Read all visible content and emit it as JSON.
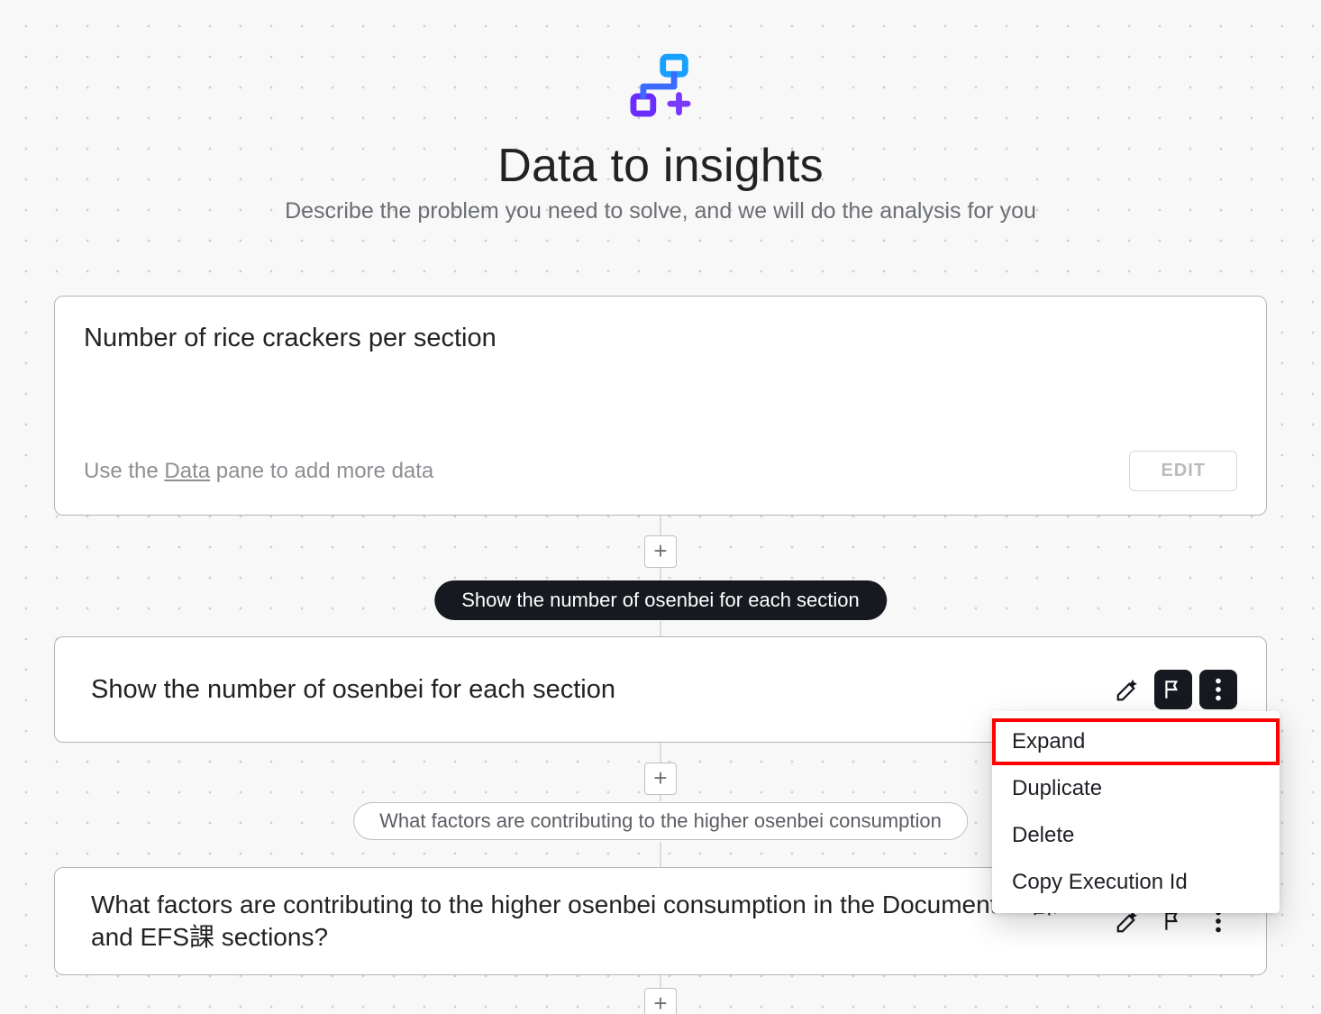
{
  "header": {
    "title": "Data to insights",
    "subtitle": "Describe the problem you need to solve, and we will do the analysis for you"
  },
  "card1": {
    "title": "Number of rice crackers per section",
    "hint_prefix": "Use the ",
    "hint_link": "Data",
    "hint_suffix": " pane to add more data",
    "edit_label": "EDIT"
  },
  "chip_dark": "Show the number of osenbei for each section",
  "card2": {
    "title": "Show the number of osenbei for each section"
  },
  "chip_light": "What factors are contributing to the higher osenbei consumption",
  "card3": {
    "title": "What factors are contributing to the higher osenbei consumption in the DocumentDB課 and EFS課 sections?"
  },
  "menu": {
    "items": [
      "Expand",
      "Duplicate",
      "Delete",
      "Copy Execution Id"
    ]
  }
}
